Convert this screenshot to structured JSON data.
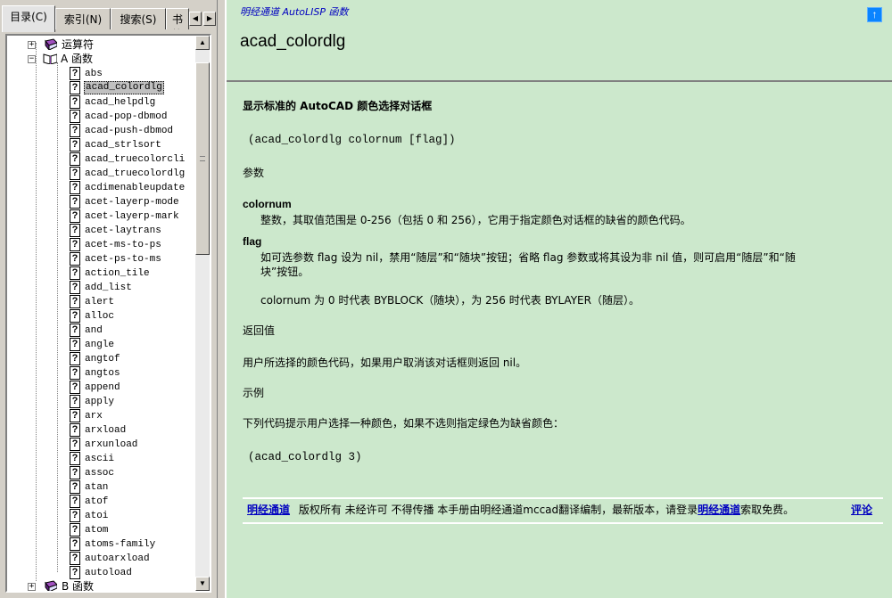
{
  "tabs": [
    {
      "label": "目录(C)",
      "active": true
    },
    {
      "label": "索引(N)",
      "active": false
    },
    {
      "label": "搜索(S)",
      "active": false
    },
    {
      "label": "书签",
      "active": false
    }
  ],
  "tree": {
    "folders_top": [
      {
        "label": "运算符",
        "expander": "+"
      },
      {
        "label": "A 函数",
        "expander": "−"
      }
    ],
    "folders_bottom": [
      {
        "label": "B 函数",
        "expander": "+"
      }
    ],
    "items": [
      "abs",
      "acad_colordlg",
      "acad_helpdlg",
      "acad-pop-dbmod",
      "acad-push-dbmod",
      "acad_strlsort",
      "acad_truecolorcli",
      "acad_truecolordlg",
      "acdimenableupdate",
      "acet-layerp-mode",
      "acet-layerp-mark",
      "acet-laytrans",
      "acet-ms-to-ps",
      "acet-ps-to-ms",
      "action_tile",
      "add_list",
      "alert",
      "alloc",
      "and",
      "angle",
      "angtof",
      "angtos",
      "append",
      "apply",
      "arx",
      "arxload",
      "arxunload",
      "ascii",
      "assoc",
      "atan",
      "atof",
      "atoi",
      "atom",
      "atoms-family",
      "autoarxload",
      "autoload"
    ],
    "selected": "acad_colordlg"
  },
  "header": {
    "breadcrumb": "明经通道  AutoLISP 函数",
    "title": "acad_colordlg",
    "top_button": "↑"
  },
  "content": {
    "summary": "显示标准的  AutoCAD 颜色选择对话框",
    "syntax": "(acad_colordlg colornum [flag])",
    "params_heading": "参数",
    "param1_name": "colornum",
    "param1_desc": "整数，其取值范围是  0-256（包括  0 和  256），它用于指定颜色对话框的缺省的颜色代码。",
    "param2_name": "flag",
    "param2_desc_line1": "如可选参数  flag 设为  nil，禁用“随层”和“随块”按钮；省略  flag 参数或将其设为非  nil 值，则可启用“随层”和“随",
    "param2_desc_line2": "块”按钮。",
    "param2_note": "colornum 为  0 时代表  BYBLOCK（随块），为  256 时代表  BYLAYER（随层）。",
    "return_heading": "返回值",
    "return_desc": "用户所选择的颜色代码，如果用户取消该对话框则返回  nil。",
    "example_heading": "示例",
    "example_desc": "下列代码提示用户选择一种颜色，如果不选则指定绿色为缺省颜色：",
    "example_code": "(acad_colordlg 3)"
  },
  "footer": {
    "link1": "明经通道",
    "text1": "版权所有  未经许可  不得传播   本手册由明经通道mccad翻译编制，最新版本，请登录",
    "link2": "明经通道",
    "text2": "索取免费。",
    "comment_link": "评论"
  },
  "colors": {
    "content_bg": "#cce8cc",
    "link": "#0000c0",
    "chrome": "#d4d0c8"
  }
}
